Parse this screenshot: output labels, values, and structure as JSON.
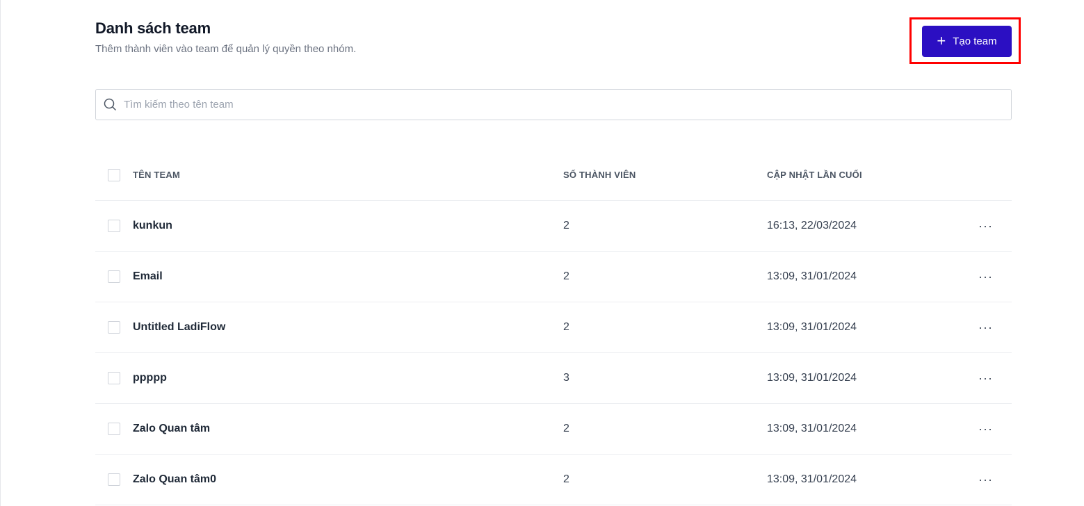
{
  "header": {
    "title": "Danh sách team",
    "subtitle": "Thêm thành viên vào team để quản lý quyền theo nhóm.",
    "create_button_label": "Tạo team",
    "create_button_icon": "plus-icon",
    "accent_color": "#2b0fc2",
    "highlight_color": "#ff0000"
  },
  "search": {
    "placeholder": "Tìm kiếm theo tên team",
    "value": "",
    "icon": "search-icon"
  },
  "table": {
    "columns": {
      "name": "TÊN TEAM",
      "members": "SỐ THÀNH VIÊN",
      "updated": "CẬP NHẬT LẦN CUỐI"
    },
    "rows": [
      {
        "name": "kunkun",
        "members": "2",
        "updated": "16:13, 22/03/2024",
        "actions_label": "···"
      },
      {
        "name": "Email",
        "members": "2",
        "updated": "13:09, 31/01/2024",
        "actions_label": "···"
      },
      {
        "name": "Untitled LadiFlow",
        "members": "2",
        "updated": "13:09, 31/01/2024",
        "actions_label": "···"
      },
      {
        "name": "ppppp",
        "members": "3",
        "updated": "13:09, 31/01/2024",
        "actions_label": "···"
      },
      {
        "name": "Zalo Quan tâm",
        "members": "2",
        "updated": "13:09, 31/01/2024",
        "actions_label": "···"
      },
      {
        "name": "Zalo Quan tâm0",
        "members": "2",
        "updated": "13:09, 31/01/2024",
        "actions_label": "···"
      }
    ]
  }
}
